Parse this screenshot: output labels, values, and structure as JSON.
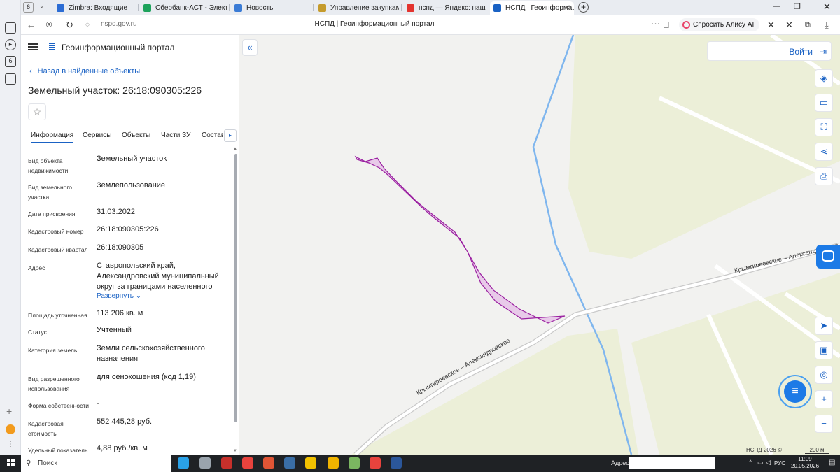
{
  "browser": {
    "tab_counter": "6",
    "tabs": [
      {
        "label": "Zimbra: Входящие",
        "color": "#2b6cd4"
      },
      {
        "label": "Сбербанк-АСТ - Электро",
        "color": "#1da25b"
      },
      {
        "label": "Новость",
        "color": "#3a7bd5"
      },
      {
        "label": "Управление закупками",
        "color": "#c59b2c"
      },
      {
        "label": "нспд — Яндекс: нашлось",
        "color": "#e3342f"
      },
      {
        "label": "НСПД | Геоинформаци",
        "color": "#1a62c4"
      }
    ],
    "new_tab_label": "+",
    "url": "nspd.gov.ru",
    "page_title": "НСПД | Геоинформационный портал",
    "more_label": "···",
    "alice_label": "Спросить Алису AI"
  },
  "panel": {
    "portal_name": "Геоинформационный портал",
    "back_label": "Назад в найденные объекты",
    "title": "Земельный участок: 26:18:090305:226",
    "star_icon": "☆",
    "tabs": [
      "Информация",
      "Сервисы",
      "Объекты",
      "Части ЗУ",
      "Состав"
    ],
    "tabs_more": "▸",
    "properties": [
      {
        "label": "Вид объекта недвижимости",
        "value": "Земельный участок"
      },
      {
        "label": "Вид земельного участка",
        "value": "Землепользование"
      },
      {
        "label": "Дата присвоения",
        "value": "31.03.2022"
      },
      {
        "label": "Кадастровый номер",
        "value": "26:18:090305:226"
      },
      {
        "label": "Кадастровый квартал",
        "value": "26:18:090305"
      },
      {
        "label": "Адрес",
        "value": "Ставропольский край, Александровский муниципальный округ за границами населенного"
      },
      {
        "label": "Площадь уточненная",
        "value": "113 206 кв. м"
      },
      {
        "label": "Статус",
        "value": "Учтенный"
      },
      {
        "label": "Категория земель",
        "value": "Земли сельскохозяйственного назначения"
      },
      {
        "label": "Вид разрешенного использования",
        "value": "для сенокошения (код 1,19)"
      },
      {
        "label": "Форма собственности",
        "value": "-"
      },
      {
        "label": "Кадастровая стоимость",
        "value": "552 445,28 руб."
      },
      {
        "label": "Удельный показатель",
        "value": "4,88 руб./кв. м"
      }
    ],
    "expand_label": "Развернуть",
    "collapse_icon": "«"
  },
  "map": {
    "login_label": "Войти",
    "road_label_upper": "Крымгиреевское – Александровское",
    "road_label_lower": "Крымгиреевское – Александровское",
    "attribution": "НСПД 2026 ©",
    "scale_label": "200 м",
    "colors": {
      "parcel_fill": "#e6c3e8",
      "parcel_stroke": "#9a1fa0",
      "field": "#ecefd8",
      "canal": "#7fb6ee"
    },
    "tools": [
      {
        "name": "layers-icon",
        "glyph": "◈"
      },
      {
        "name": "ruler-icon",
        "glyph": "▭"
      },
      {
        "name": "select-area-icon",
        "glyph": "⛶"
      },
      {
        "name": "share-icon",
        "glyph": "⋖"
      },
      {
        "name": "print-icon",
        "glyph": "⎙"
      }
    ],
    "nav_tools": [
      {
        "name": "locate-icon",
        "glyph": "➤"
      },
      {
        "name": "basemap-icon",
        "glyph": "▣"
      },
      {
        "name": "geo-search-icon",
        "glyph": "◎"
      },
      {
        "name": "zoom-in-icon",
        "glyph": "+"
      },
      {
        "name": "zoom-out-icon",
        "glyph": "−"
      }
    ],
    "chat_icon": "≡"
  },
  "taskbar": {
    "search_label": "Поиск",
    "address_label": "Адрес",
    "address_value": "",
    "lang": "РУС",
    "time": "11:09",
    "date": "20.05.2026",
    "apps": [
      "#2aa2e8",
      "#9aa4ad",
      "#c6302b",
      "#e8433d",
      "#e05535",
      "#3a6ea5",
      "#f2c200",
      "#f0b400",
      "#7bb661",
      "#e8433d",
      "#2b579a"
    ]
  }
}
